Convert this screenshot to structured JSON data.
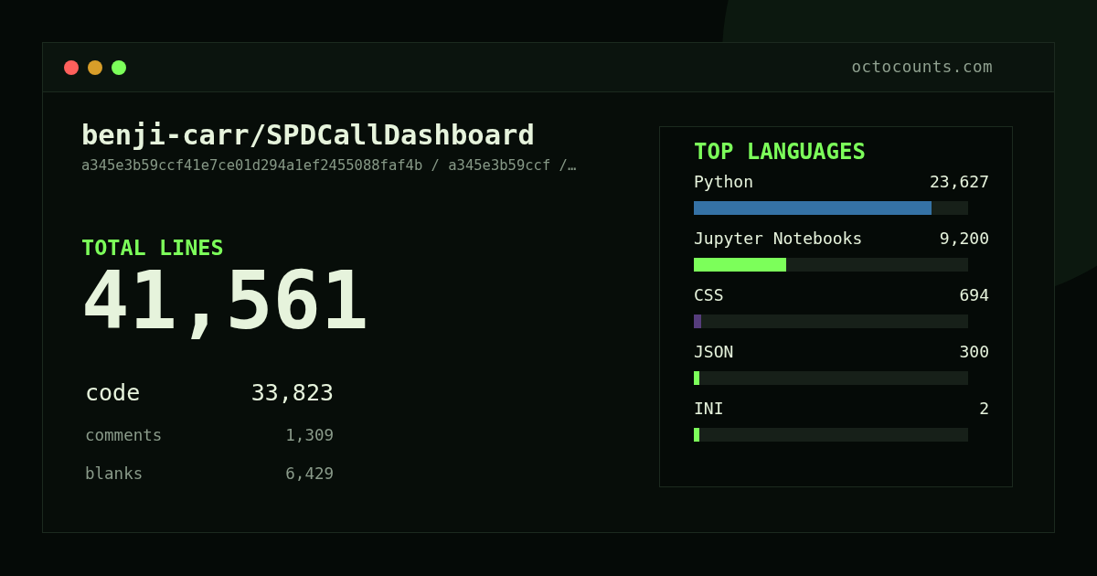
{
  "window": {
    "controls": [
      {
        "color": "#ff605c"
      },
      {
        "color": "#d89e29"
      },
      {
        "color": "#7cff5a"
      }
    ],
    "site": "octocounts.com"
  },
  "repo": {
    "name": "benji-carr/SPDCallDashboard",
    "path": "a345e3b59ccf41e7ce01d294a1ef2455088faf4b / a345e3b59ccf /…"
  },
  "total": {
    "label": "TOTAL LINES",
    "value": "41,561"
  },
  "breakdown": [
    {
      "kind": "primary",
      "label": "code",
      "value": "33,823"
    },
    {
      "kind": "secondary",
      "label": "comments",
      "value": "1,309"
    },
    {
      "kind": "secondary",
      "label": "blanks",
      "value": "6,429"
    }
  ],
  "languages": {
    "title": "TOP LANGUAGES",
    "items": [
      {
        "name": "Python",
        "lines": "23,627",
        "level": 0.867,
        "color": "#3572a5"
      },
      {
        "name": "Jupyter Notebooks",
        "lines": "9,200",
        "level": 0.337,
        "color": "#7cff5a"
      },
      {
        "name": "CSS",
        "lines": "694",
        "level": 0.027,
        "color": "#563d7c"
      },
      {
        "name": "JSON",
        "lines": "300",
        "level": 0.02,
        "color": "#7cff5a"
      },
      {
        "name": "INI",
        "lines": "2",
        "level": 0.02,
        "color": "#7cff5a"
      }
    ]
  }
}
